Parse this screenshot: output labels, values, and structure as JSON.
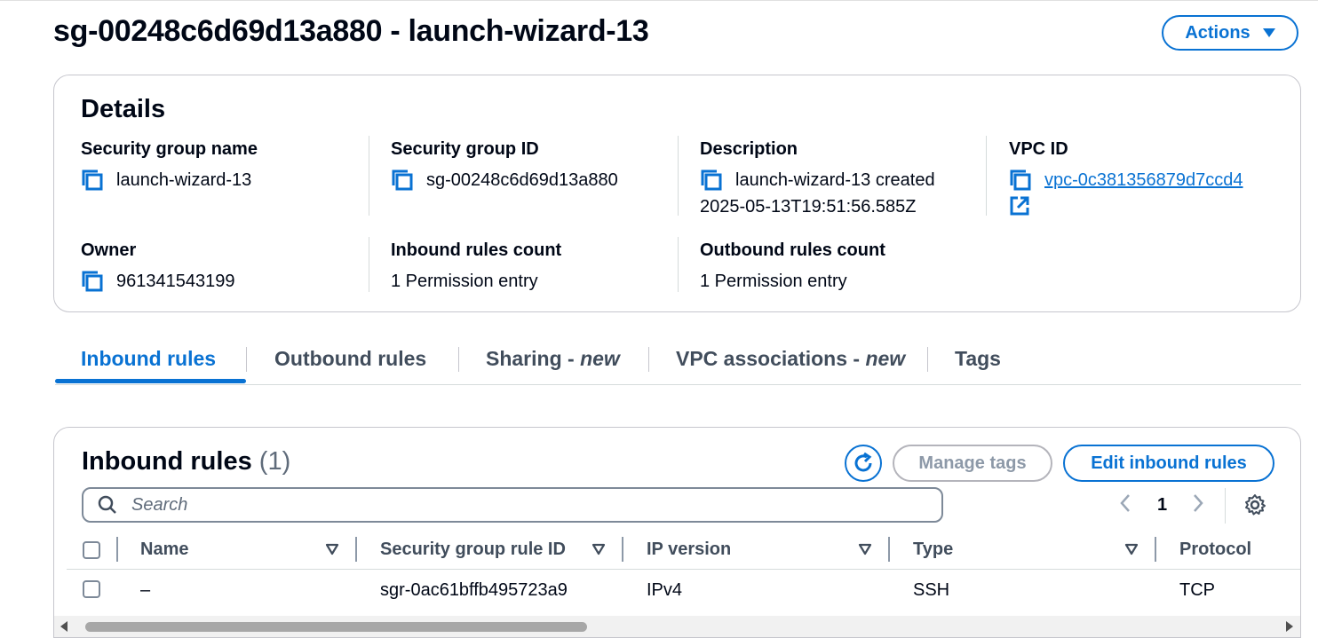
{
  "header": {
    "title": "sg-00248c6d69d13a880 - launch-wizard-13",
    "actions_label": "Actions"
  },
  "details": {
    "title": "Details",
    "security_group_name": {
      "label": "Security group name",
      "value": "launch-wizard-13"
    },
    "security_group_id": {
      "label": "Security group ID",
      "value": "sg-00248c6d69d13a880"
    },
    "description": {
      "label": "Description",
      "value_line1": "launch-wizard-13 created",
      "value_line2": "2025-05-13T19:51:56.585Z"
    },
    "vpc_id": {
      "label": "VPC ID",
      "value": "vpc-0c381356879d7ccd4"
    },
    "owner": {
      "label": "Owner",
      "value": "961341543199"
    },
    "inbound_rules_count": {
      "label": "Inbound rules count",
      "value": "1 Permission entry"
    },
    "outbound_rules_count": {
      "label": "Outbound rules count",
      "value": "1 Permission entry"
    }
  },
  "tabs": [
    {
      "label": "Inbound rules",
      "suffix": ""
    },
    {
      "label": "Outbound rules",
      "suffix": ""
    },
    {
      "label": "Sharing - ",
      "suffix": "new"
    },
    {
      "label": "VPC associations - ",
      "suffix": "new"
    },
    {
      "label": "Tags",
      "suffix": ""
    }
  ],
  "inbound_rules": {
    "title": "Inbound rules",
    "count": "(1)",
    "manage_tags_label": "Manage tags",
    "edit_label": "Edit inbound rules",
    "search_placeholder": "Search",
    "page_number": "1",
    "columns": [
      "Name",
      "Security group rule ID",
      "IP version",
      "Type",
      "Protocol"
    ],
    "rows": [
      {
        "name": "–",
        "rule_id": "sgr-0ac61bffb495723a9",
        "ip_version": "IPv4",
        "type": "SSH",
        "protocol": "TCP"
      }
    ]
  },
  "colors": {
    "accent": "#0972d3",
    "text": "#000716",
    "muted": "#5f6b7a",
    "border": "#c6c6cd"
  },
  "icons": [
    "copy-icon",
    "external-link-icon",
    "refresh-icon",
    "search-icon",
    "chevron-left-icon",
    "chevron-right-icon",
    "gear-icon",
    "sort-icon"
  ]
}
